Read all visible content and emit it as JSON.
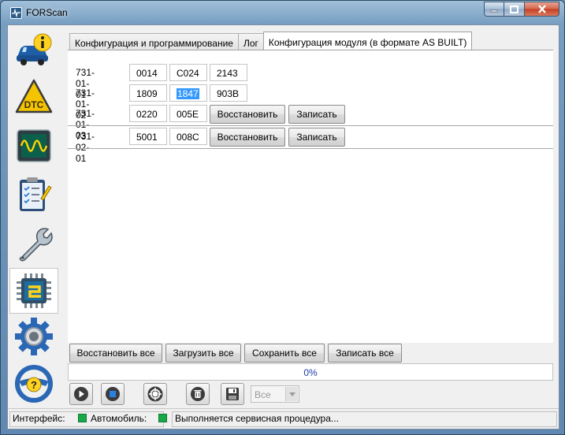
{
  "window": {
    "title": "FORScan"
  },
  "colors": {
    "accent": "#3399ff",
    "status_ok": "#18a84a",
    "progress_text": "#1f3fa8"
  },
  "sidebar": {
    "items": [
      {
        "name": "vehicle-info",
        "icon": "car-info-icon"
      },
      {
        "name": "dtc",
        "icon": "dtc-warning-icon",
        "label": "DTC"
      },
      {
        "name": "oscilloscope",
        "icon": "oscilloscope-icon"
      },
      {
        "name": "tests",
        "icon": "checklist-icon"
      },
      {
        "name": "service",
        "icon": "wrench-icon"
      },
      {
        "name": "configuration",
        "icon": "chip-icon",
        "active": true
      },
      {
        "name": "settings",
        "icon": "gear-icon"
      },
      {
        "name": "help",
        "icon": "steering-help-icon",
        "label": "?"
      }
    ]
  },
  "tabs": [
    {
      "label": "Конфигурация и программирование",
      "active": false
    },
    {
      "label": "Лог",
      "active": false
    },
    {
      "label": "Конфигурация модуля (в формате AS BUILT)",
      "active": true
    }
  ],
  "asbuilt": {
    "rows": [
      {
        "address": "731-01-01",
        "values": [
          "0014",
          "C024",
          "2143"
        ]
      },
      {
        "address": "731-01-02",
        "values": [
          "1809",
          "1847",
          "903B"
        ],
        "selected_index": 1
      },
      {
        "address": "731-01-03",
        "values": [
          "0220",
          "005E"
        ],
        "restore_label": "Восстановить",
        "write_label": "Записать"
      },
      {
        "address": "731-02-01",
        "values": [
          "5001",
          "008C"
        ],
        "restore_label": "Восстановить",
        "write_label": "Записать"
      }
    ]
  },
  "bottom_buttons": {
    "restore_all": "Восстановить все",
    "load_all": "Загрузить все",
    "save_all": "Сохранить все",
    "write_all": "Записать все"
  },
  "progress": {
    "value": 0,
    "text": "0%"
  },
  "toolbar": {
    "buttons": [
      "play-icon",
      "stop-icon",
      "lifebuoy-icon",
      "delete-icon",
      "save-disk-icon"
    ],
    "filter": {
      "selected": "Все"
    }
  },
  "statusbar": {
    "interface_label": "Интерфейс:",
    "vehicle_label": "Автомобиль:",
    "message": "Выполняется сервисная процедура..."
  }
}
